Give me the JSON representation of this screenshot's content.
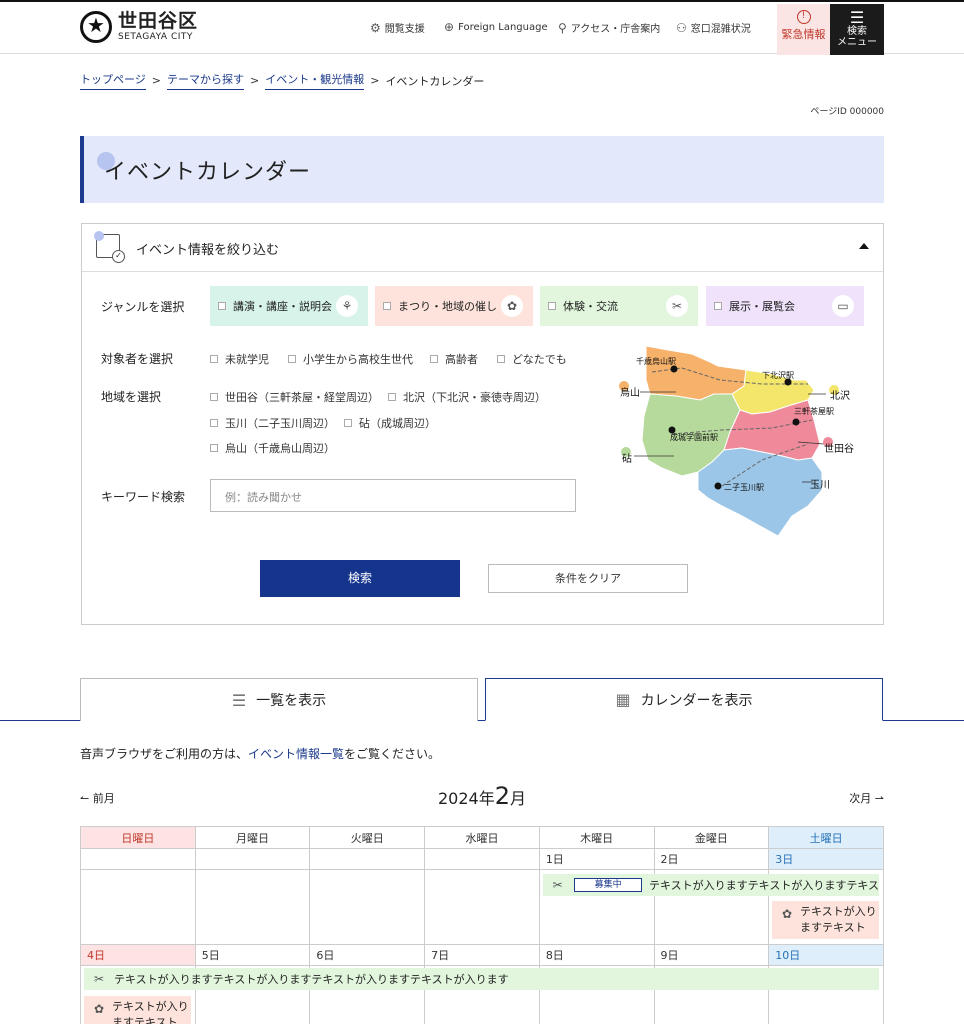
{
  "header": {
    "logo_ja": "世田谷区",
    "logo_en": "SETAGAYA CITY",
    "nav": [
      {
        "label": "閲覧支援",
        "icon": "gear-icon"
      },
      {
        "label": "Foreign Language",
        "icon": "globe-icon"
      },
      {
        "label": "アクセス・庁舎案内",
        "icon": "map-pin-icon"
      },
      {
        "label": "窓口混雑状況",
        "icon": "people-icon"
      }
    ],
    "emergency": "緊急情報",
    "menu_line1": "検索",
    "menu_line2": "メニュー"
  },
  "breadcrumb": {
    "items": [
      "トップページ",
      "テーマから探す",
      "イベント・観光情報"
    ],
    "current": "イベントカレンダー"
  },
  "page_id": "ページID 000000",
  "page_title": "イベントカレンダー",
  "filter": {
    "heading": "イベント情報を絞り込む",
    "genre_label": "ジャンルを選択",
    "genres": [
      {
        "label": "講演・講座・説明会",
        "color": "#d7f3ea"
      },
      {
        "label": "まつり・地域の催し",
        "color": "#fde3dc"
      },
      {
        "label": "体験・交流",
        "color": "#e2f6dd"
      },
      {
        "label": "展示・展覧会",
        "color": "#efe2fa"
      }
    ],
    "target_label": "対象者を選択",
    "targets": [
      "未就学児",
      "小学生から高校生世代",
      "高齢者",
      "どなたでも"
    ],
    "area_label": "地域を選択",
    "areas": [
      "世田谷（三軒茶屋・経堂周辺）",
      "北沢（下北沢・豪徳寺周辺）",
      "玉川（二子玉川周辺）",
      "砧（成城周辺）",
      "烏山（千歳烏山周辺）"
    ],
    "keyword_label": "キーワード検索",
    "keyword_placeholder": "例：読み聞かせ",
    "search_button": "検索",
    "clear_button": "条件をクリア",
    "map": {
      "stations": [
        "千歳烏山駅",
        "下北沢駅",
        "三軒茶屋駅",
        "成城学園前駅",
        "二子玉川駅"
      ],
      "regions": [
        "烏山",
        "北沢",
        "世田谷",
        "砧",
        "玉川"
      ]
    }
  },
  "tabs": {
    "list": "一覧を表示",
    "calendar": "カレンダーを表示"
  },
  "note": {
    "before": "音声ブラウザをご利用の方は、",
    "link": "イベント情報一覧",
    "after": "をご覧ください。"
  },
  "calendar": {
    "prev": "前月",
    "next": "次月",
    "year_label": "2024年",
    "month_num": "2",
    "month_suffix": "月",
    "weekdays": [
      "日曜日",
      "月曜日",
      "火曜日",
      "水曜日",
      "木曜日",
      "金曜日",
      "土曜日"
    ],
    "week1": [
      "",
      "",
      "",
      "",
      "1日",
      "2日",
      "3日"
    ],
    "week2": [
      "4日",
      "5日",
      "6日",
      "7日",
      "8日",
      "9日",
      "10日"
    ],
    "events": {
      "e1_badge": "募集中",
      "e1_text": "テキストが入りますテキストが入りますテキス",
      "e2_text_l1": "テキストが入り",
      "e2_text_l2": "ますテキスト",
      "e3_text": "テキストが入りますテキストが入りますテキストが入りますテキストが入ります",
      "e4_text_l1": "テキストが入り",
      "e4_text_l2": "ますテキスト"
    }
  }
}
